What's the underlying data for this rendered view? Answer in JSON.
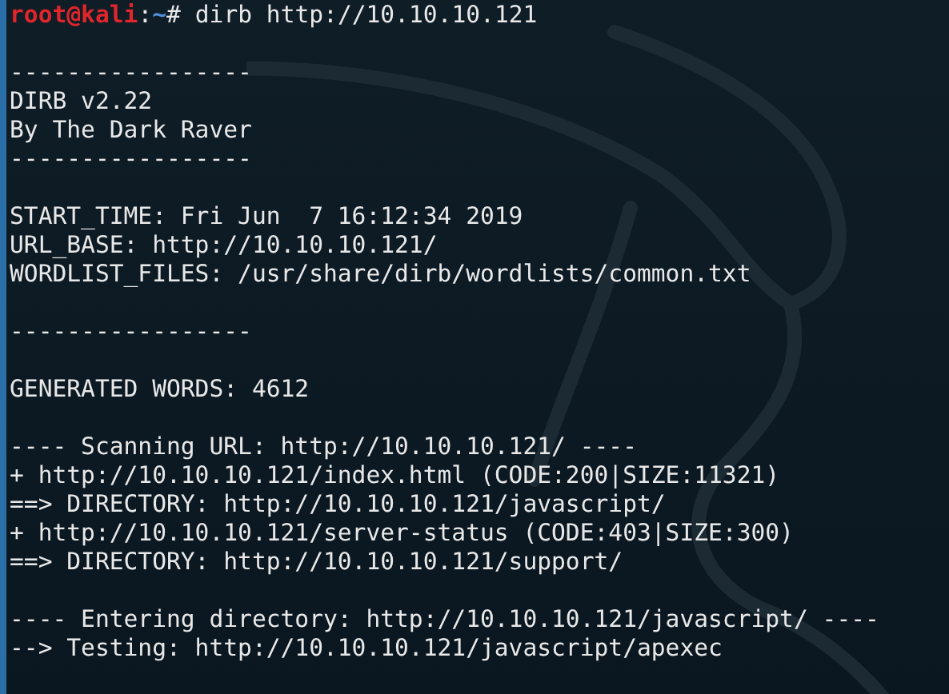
{
  "prompt": {
    "user": "root@kali",
    "separator": ":",
    "path": "~",
    "symbol": "#",
    "command": "dirb http://10.10.10.121"
  },
  "blocks": [
    [
      "-----------------",
      "DIRB v2.22",
      "By The Dark Raver",
      "-----------------"
    ],
    [
      "START_TIME: Fri Jun  7 16:12:34 2019",
      "URL_BASE: http://10.10.10.121/",
      "WORDLIST_FILES: /usr/share/dirb/wordlists/common.txt"
    ],
    [
      "-----------------"
    ],
    [
      "GENERATED WORDS: 4612"
    ],
    [
      "---- Scanning URL: http://10.10.10.121/ ----",
      "+ http://10.10.10.121/index.html (CODE:200|SIZE:11321)",
      "==> DIRECTORY: http://10.10.10.121/javascript/",
      "+ http://10.10.10.121/server-status (CODE:403|SIZE:300)",
      "==> DIRECTORY: http://10.10.10.121/support/"
    ],
    [
      "---- Entering directory: http://10.10.10.121/javascript/ ----",
      "--> Testing: http://10.10.10.121/javascript/apexec"
    ]
  ]
}
